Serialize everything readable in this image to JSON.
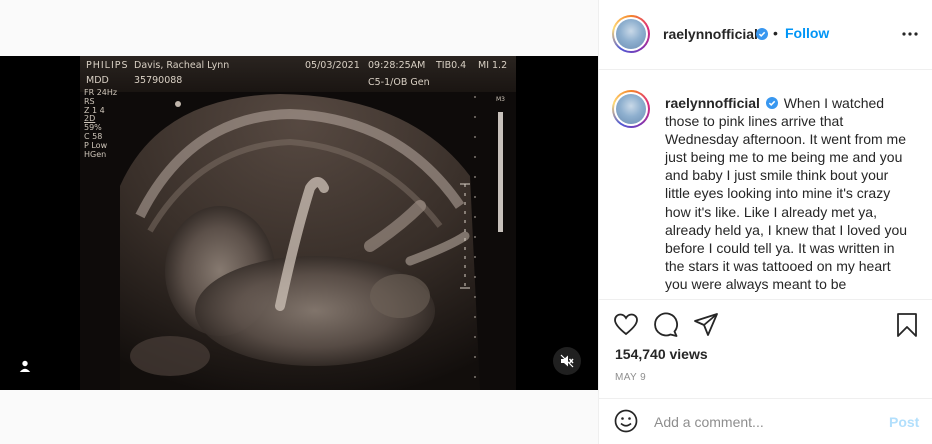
{
  "post": {
    "username": "raelynnofficial",
    "follow_label": "Follow",
    "separator": "•",
    "caption_user": "raelynnofficial",
    "caption_text": "When I watched those to pink lines arrive that Wednesday afternoon. It went from me just being me to me being me and you and baby I just smile think bout your little eyes looking into mine it's crazy how it's like. Like I already met ya, already held ya, I knew that I loved you before I could tell ya. It was written in the stars it was tattooed on my heart you were always meant to be",
    "views": "154,740 views",
    "date": "MAY 9",
    "comment_placeholder": "Add a comment...",
    "post_label": "Post"
  },
  "ultrasound": {
    "brand": "PHILIPS",
    "patient": "Davis, Racheal Lynn",
    "date": "05/03/2021",
    "time": "09:28:25AM",
    "tib": "TIB0.4",
    "mi": "MI 1.2",
    "mdd": "MDD",
    "id": "35790088",
    "probe": "C5-1/OB Gen",
    "params": [
      "FR 24Hz",
      "RS",
      "Z 1 4",
      "2D",
      "59%",
      "C 58",
      "P Low",
      "HGen"
    ],
    "scale_label": "M3"
  },
  "icons": {
    "like": "heart-icon",
    "comment": "comment-icon",
    "share": "paper-plane-icon",
    "save": "bookmark-icon",
    "emoji": "smiley-icon",
    "more": "more-dots-icon",
    "verified": "verified-badge-icon",
    "mute": "speaker-muted-icon",
    "tag": "user-tag-icon"
  },
  "colors": {
    "accent": "#0095f6",
    "verified": "#3897f0",
    "post_disabled": "#b2dffc"
  }
}
